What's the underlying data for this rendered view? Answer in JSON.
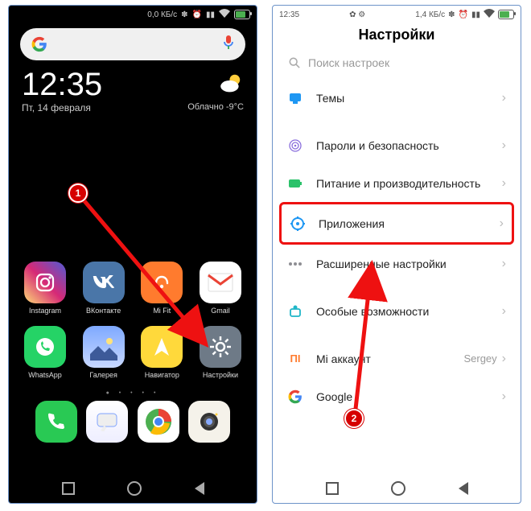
{
  "left": {
    "statusbar": {
      "net_speed": "0,0 КБ/с"
    },
    "clock": "12:35",
    "date": "Пт, 14 февраля",
    "weather": "Облачно -9°C",
    "apps": {
      "row1": [
        {
          "label": "Instagram"
        },
        {
          "label": "ВКонтакте"
        },
        {
          "label": "Mi Fit"
        },
        {
          "label": "Gmail"
        }
      ],
      "row2": [
        {
          "label": "WhatsApp"
        },
        {
          "label": "Галерея"
        },
        {
          "label": "Навигатор"
        },
        {
          "label": "Настройки"
        }
      ]
    }
  },
  "right": {
    "statusbar": {
      "time": "12:35",
      "net_speed": "1,4 КБ/с"
    },
    "title": "Настройки",
    "search_placeholder": "Поиск настроек",
    "items": [
      {
        "label": "Темы"
      },
      {
        "label": "Пароли и безопасность"
      },
      {
        "label": "Питание и производительность"
      },
      {
        "label": "Приложения"
      },
      {
        "label": "Расширенные настройки"
      },
      {
        "label": "Особые возможности"
      },
      {
        "label": "Mi аккаунт",
        "value": "Sergey"
      },
      {
        "label": "Google"
      }
    ]
  },
  "steps": {
    "one": "1",
    "two": "2"
  }
}
